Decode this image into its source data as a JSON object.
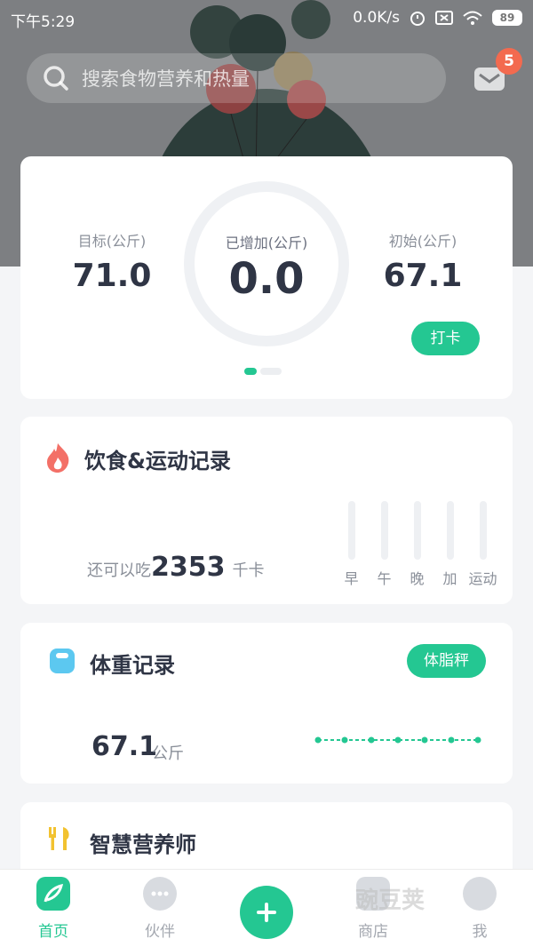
{
  "status_bar": {
    "time": "下午5:29",
    "network_speed": "0.0K/s",
    "battery": "89"
  },
  "header": {
    "search_placeholder": "搜索食物营养和热量",
    "message_count": "5"
  },
  "summary": {
    "target_label": "目标(公斤)",
    "target_value": "71.0",
    "increased_label": "已增加(公斤)",
    "increased_value": "0.0",
    "initial_label": "初始(公斤)",
    "initial_value": "67.1",
    "checkin_label": "打卡"
  },
  "diet": {
    "title": "饮食&运动记录",
    "remain_prefix": "还可以吃",
    "remain_value": "2353",
    "remain_unit": "千卡",
    "meals": [
      "早",
      "午",
      "晚",
      "加",
      "运动"
    ]
  },
  "weight_record": {
    "title": "体重记录",
    "scale_button": "体脂秤",
    "current_value": "67.1",
    "current_unit": "公斤"
  },
  "nutritionist": {
    "title": "智慧营养师"
  },
  "tabs": [
    {
      "label": "首页"
    },
    {
      "label": "伙伴"
    },
    {
      "label": "商店"
    },
    {
      "label": "我"
    }
  ],
  "watermark": "豌豆荚",
  "colors": {
    "accent": "#24c792",
    "badge": "#f36a4f",
    "text_dark": "#2f3545",
    "text_muted": "#8a8f99"
  },
  "icons": {
    "search": "search-icon",
    "mail": "mail-icon",
    "flame": "flame-icon",
    "scale": "scale-icon",
    "cutlery": "cutlery-icon",
    "home": "home-leaf-icon",
    "chat": "chat-icon",
    "add": "plus-icon",
    "shop": "shop-icon",
    "profile": "profile-icon"
  }
}
